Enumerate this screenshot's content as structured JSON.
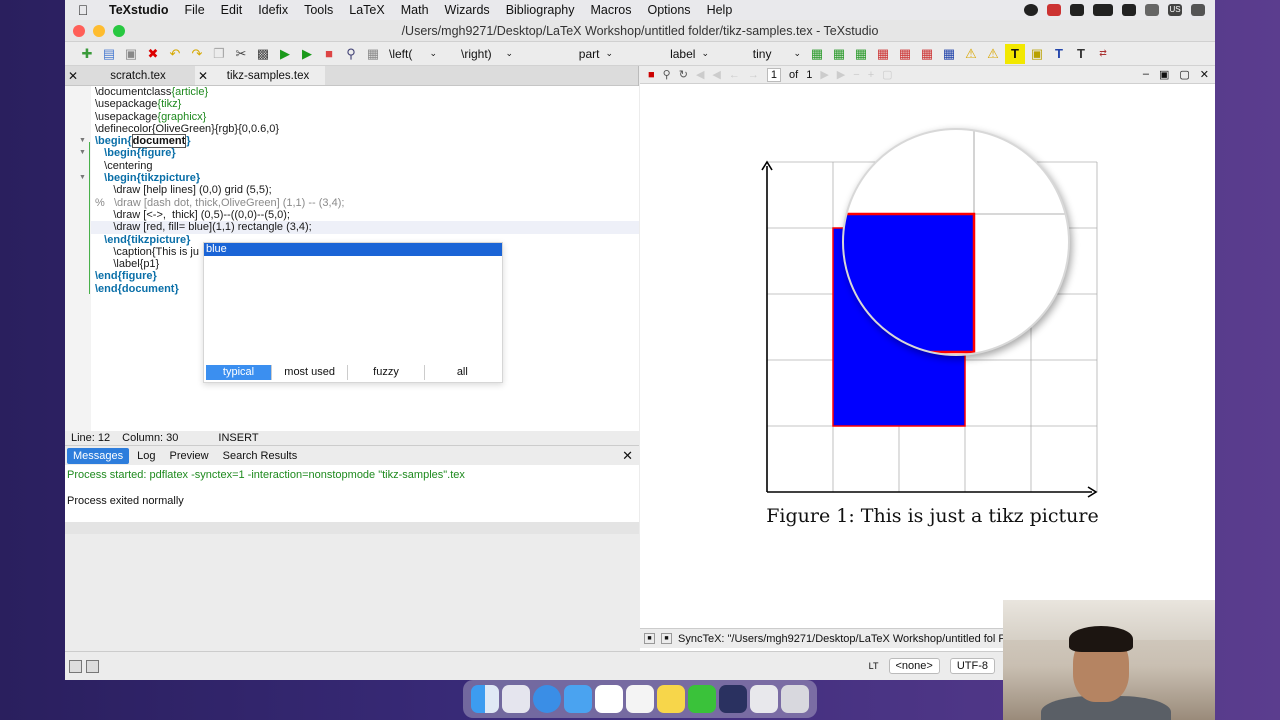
{
  "menubar": {
    "app": "TeXstudio",
    "items": [
      "File",
      "Edit",
      "Idefix",
      "Tools",
      "LaTeX",
      "Math",
      "Wizards",
      "Bibliography",
      "Macros",
      "Options",
      "Help"
    ],
    "tray_label": "US"
  },
  "window": {
    "title": "/Users/mgh9271/Desktop/LaTeX Workshop/untitled folder/tikz-samples.tex - TeXstudio"
  },
  "toolbar": {
    "left_label": "\\left(",
    "right_label": "\\right)",
    "part_label": "part",
    "label_label": "label",
    "size_label": "tiny"
  },
  "tabs": [
    {
      "label": "scratch.tex",
      "active": false
    },
    {
      "label": "tikz-samples.tex",
      "active": true
    }
  ],
  "code": {
    "l1_cmd": "\\documentclass",
    "l1_arg": "{article}",
    "l2_cmd": "\\usepackage",
    "l2_arg": "{tikz}",
    "l3_cmd": "\\usepackage",
    "l3_arg": "{graphicx}",
    "l4": "\\definecolor{OliveGreen}{rgb}{0,0.6,0}",
    "l5_kw": "\\begin",
    "l5_arg": "document",
    "l6_kw": "\\begin",
    "l6_arg": "figure",
    "l7": "\\centering",
    "l8_kw": "\\begin",
    "l8_arg": "tikzpicture",
    "l9": "\\draw [help lines] (0,0) grid (5,5);",
    "l10": "%   \\draw [dash dot, thick,OliveGreen] (1,1) -- (3,4);",
    "l11": "\\draw [<->,  thick] (0,5)--((0,0)--(5,0);",
    "l12": "\\draw [red, fill= blue](1,1) rectangle (3,4);",
    "l13_kw": "\\end",
    "l13_arg": "tikzpicture",
    "l14": "\\caption{This is ju",
    "l15": "\\label{p1}",
    "l16_kw": "\\end",
    "l16_arg": "figure",
    "l17_kw": "\\end",
    "l17_arg": "document"
  },
  "autocomplete": {
    "selected": "blue",
    "tabs": [
      "typical",
      "most used",
      "fuzzy",
      "all"
    ]
  },
  "status": {
    "line": "Line: 12",
    "column": "Column: 30",
    "mode": "INSERT"
  },
  "messages": {
    "tabs": [
      "Messages",
      "Log",
      "Preview",
      "Search Results"
    ],
    "line1": "Process started: pdflatex -synctex=1 -interaction=nonstopmode \"tikz-samples\".tex",
    "line2": "Process exited normally"
  },
  "pdf": {
    "page_current": "1",
    "page_of": "of",
    "page_total": "1",
    "caption": "Figure 1:  This is just a tikz picture",
    "fill_color": "#0000ff",
    "stroke_color": "#ff0000"
  },
  "synctex": "SyncTeX: \"/Users/mgh9271/Desktop/LaTeX Workshop/untitled fol Pa",
  "bottombar": {
    "lt": "LT",
    "none": "<none>",
    "encoding": "UTF-8"
  }
}
